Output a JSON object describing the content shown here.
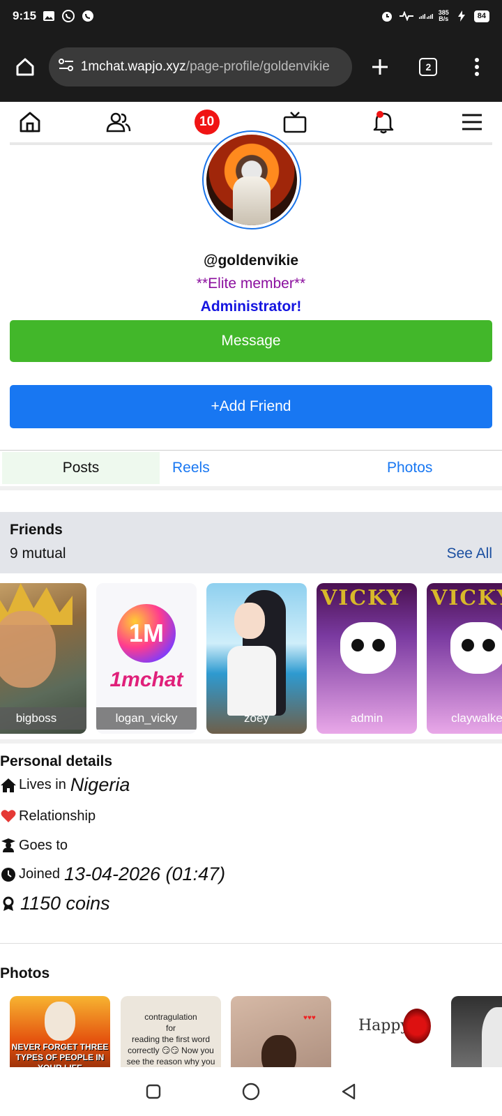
{
  "status_bar": {
    "time": "9:15",
    "network_speed": "385\nB/s",
    "battery": "84"
  },
  "browser": {
    "url_domain": "1mchat.wapjo.xyz",
    "url_path": "/page-profile/goldenvikie",
    "tab_count": "2"
  },
  "nav": {
    "messages_badge": "10"
  },
  "profile": {
    "username": "@goldenvikie",
    "rank": "**Elite member**",
    "role": "Administrator!",
    "message_button": "Message",
    "add_friend_button": "+Add Friend"
  },
  "tabs": [
    {
      "label": "Posts",
      "active": true
    },
    {
      "label": "Reels",
      "active": false
    },
    {
      "label": "Photos",
      "active": false
    }
  ],
  "friends": {
    "title": "Friends",
    "mutual": "9 mutual",
    "see_all": "See All",
    "items": [
      {
        "name": "bigboss"
      },
      {
        "name": "logan_vicky"
      },
      {
        "name": "zoey"
      },
      {
        "name": "admin"
      },
      {
        "name": "claywalke"
      }
    ],
    "logo_text": "1mchat",
    "logo_badge": "1M",
    "vicky_text": "VICKY"
  },
  "personal_details": {
    "title": "Personal details",
    "lives_label": "Lives in",
    "lives_value": "Nigeria",
    "relationship_label": "Relationship",
    "goes_label": "Goes to",
    "joined_label": "Joined",
    "joined_value": "13-04-2026 (01:47)",
    "coins_value": "1150 coins"
  },
  "photos": {
    "title": "Photos",
    "p1_text": "NEVER FORGET THREE TYPES OF PEOPLE IN YOUR LIFE",
    "p2_text": "contragulation\nfor\nreading the first word correctly 😏😏 Now you see the reason why you failed",
    "p4_text": "Happy"
  },
  "colors": {
    "message_green": "#42b72a",
    "add_friend_blue": "#1877f2",
    "elite_purple": "#8b0f9e",
    "admin_blue": "#1515e0",
    "badge_red": "#f01414"
  }
}
